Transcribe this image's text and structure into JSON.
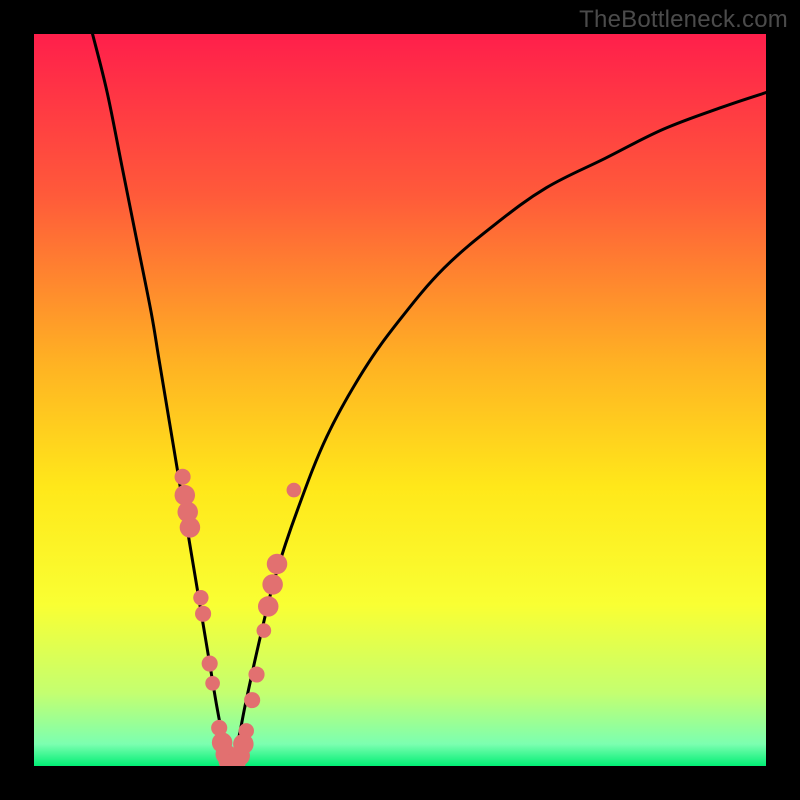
{
  "watermark": "TheBottleneck.com",
  "chart_data": {
    "type": "line",
    "title": "",
    "xlabel": "",
    "ylabel": "",
    "xlim": [
      0,
      100
    ],
    "ylim": [
      0,
      100
    ],
    "grid": false,
    "legend": false,
    "background_gradient": {
      "stops": [
        {
          "y": 0,
          "color": "#ff1f4b"
        },
        {
          "y": 22,
          "color": "#ff5a3a"
        },
        {
          "y": 45,
          "color": "#ffb223"
        },
        {
          "y": 62,
          "color": "#ffe81a"
        },
        {
          "y": 78,
          "color": "#f9ff33"
        },
        {
          "y": 90,
          "color": "#c4ff70"
        },
        {
          "y": 97,
          "color": "#7cffb0"
        },
        {
          "y": 100,
          "color": "#02ee75"
        }
      ]
    },
    "series": [
      {
        "name": "left-branch",
        "x": [
          8,
          10,
          12,
          14,
          16,
          17,
          18,
          19,
          20,
          21,
          22,
          23,
          24,
          25,
          26,
          27
        ],
        "y": [
          100,
          92,
          82,
          72,
          62,
          56,
          50,
          44,
          38,
          32,
          26,
          20,
          14,
          8,
          3,
          0
        ],
        "color": "#000000"
      },
      {
        "name": "right-branch",
        "x": [
          27,
          28,
          29,
          31,
          33,
          36,
          40,
          45,
          50,
          56,
          63,
          70,
          78,
          86,
          94,
          100
        ],
        "y": [
          0,
          4,
          9,
          18,
          26,
          35,
          45,
          54,
          61,
          68,
          74,
          79,
          83,
          87,
          90,
          92
        ],
        "color": "#000000"
      }
    ],
    "scatter": {
      "name": "dots",
      "color": "#e27070",
      "points": [
        {
          "x": 20.3,
          "y": 39.5,
          "r": 1.1
        },
        {
          "x": 20.6,
          "y": 37.0,
          "r": 1.4
        },
        {
          "x": 21.0,
          "y": 34.7,
          "r": 1.4
        },
        {
          "x": 21.3,
          "y": 32.6,
          "r": 1.4
        },
        {
          "x": 22.8,
          "y": 23.0,
          "r": 1.05
        },
        {
          "x": 23.1,
          "y": 20.8,
          "r": 1.1
        },
        {
          "x": 24.0,
          "y": 14.0,
          "r": 1.1
        },
        {
          "x": 24.4,
          "y": 11.3,
          "r": 1.0
        },
        {
          "x": 25.3,
          "y": 5.2,
          "r": 1.1
        },
        {
          "x": 25.7,
          "y": 3.2,
          "r": 1.4
        },
        {
          "x": 26.2,
          "y": 1.6,
          "r": 1.4
        },
        {
          "x": 26.6,
          "y": 0.7,
          "r": 1.4
        },
        {
          "x": 27.0,
          "y": 0.3,
          "r": 1.4
        },
        {
          "x": 27.5,
          "y": 0.4,
          "r": 1.4
        },
        {
          "x": 28.1,
          "y": 1.4,
          "r": 1.4
        },
        {
          "x": 28.6,
          "y": 3.0,
          "r": 1.4
        },
        {
          "x": 29.0,
          "y": 4.8,
          "r": 1.05
        },
        {
          "x": 29.8,
          "y": 9.0,
          "r": 1.1
        },
        {
          "x": 30.4,
          "y": 12.5,
          "r": 1.1
        },
        {
          "x": 31.4,
          "y": 18.5,
          "r": 1.0
        },
        {
          "x": 32.0,
          "y": 21.8,
          "r": 1.4
        },
        {
          "x": 32.6,
          "y": 24.8,
          "r": 1.4
        },
        {
          "x": 33.2,
          "y": 27.6,
          "r": 1.4
        },
        {
          "x": 35.5,
          "y": 37.7,
          "r": 1.0
        }
      ]
    }
  }
}
